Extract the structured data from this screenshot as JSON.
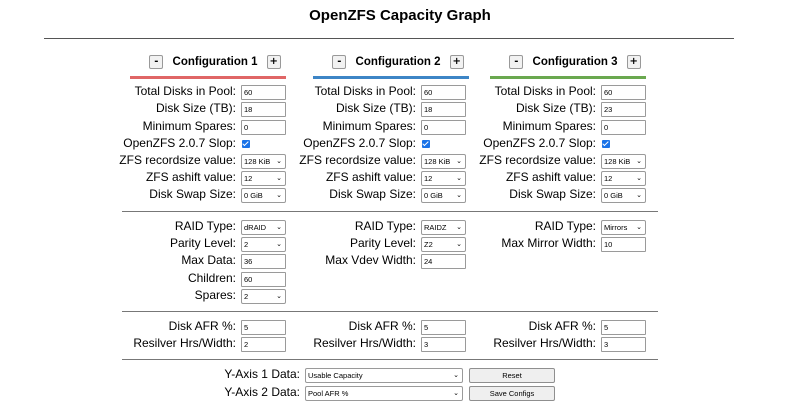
{
  "title": "OpenZFS Capacity Graph",
  "labels": {
    "total_disks": "Total Disks in Pool:",
    "disk_size": "Disk Size (TB):",
    "min_spares": "Minimum Spares:",
    "slop": "OpenZFS 2.0.7 Slop:",
    "recordsize": "ZFS recordsize value:",
    "ashift": "ZFS ashift value:",
    "swap": "Disk Swap Size:",
    "raid_type": "RAID Type:",
    "parity": "Parity Level:",
    "max_data": "Max Data:",
    "children": "Children:",
    "spares": "Spares:",
    "max_vdev": "Max Vdev Width:",
    "max_mirror": "Max Mirror Width:",
    "afr": "Disk AFR %:",
    "resilver": "Resilver Hrs/Width:",
    "y1": "Y-Axis 1 Data:",
    "y2": "Y-Axis 2 Data:"
  },
  "configs": [
    {
      "name": "Configuration 1",
      "minus": "-",
      "plus": "+",
      "color": "#e06666",
      "total_disks": "60",
      "disk_size": "18",
      "min_spares": "0",
      "slop_checked": true,
      "recordsize": "128 KiB",
      "ashift": "12",
      "swap": "0 GiB",
      "raid_type": "dRAID",
      "parity": "2",
      "max_data": "36",
      "children": "60",
      "spares": "2",
      "afr": "5",
      "resilver": "2"
    },
    {
      "name": "Configuration 2",
      "minus": "-",
      "plus": "+",
      "color": "#3d85c6",
      "total_disks": "60",
      "disk_size": "18",
      "min_spares": "0",
      "slop_checked": true,
      "recordsize": "128 KiB",
      "ashift": "12",
      "swap": "0 GiB",
      "raid_type": "RAIDZ",
      "parity": "Z2",
      "max_vdev": "24",
      "afr": "5",
      "resilver": "3"
    },
    {
      "name": "Configuration 3",
      "minus": "-",
      "plus": "+",
      "color": "#6aa84f",
      "total_disks": "60",
      "disk_size": "23",
      "min_spares": "0",
      "slop_checked": true,
      "recordsize": "128 KiB",
      "ashift": "12",
      "swap": "0 GiB",
      "raid_type": "Mirrors",
      "max_mirror": "10",
      "afr": "5",
      "resilver": "3"
    }
  ],
  "axes": {
    "y1_value": "Usable Capacity",
    "y2_value": "Pool AFR %"
  },
  "buttons": {
    "reset": "Reset",
    "save": "Save Configs"
  }
}
